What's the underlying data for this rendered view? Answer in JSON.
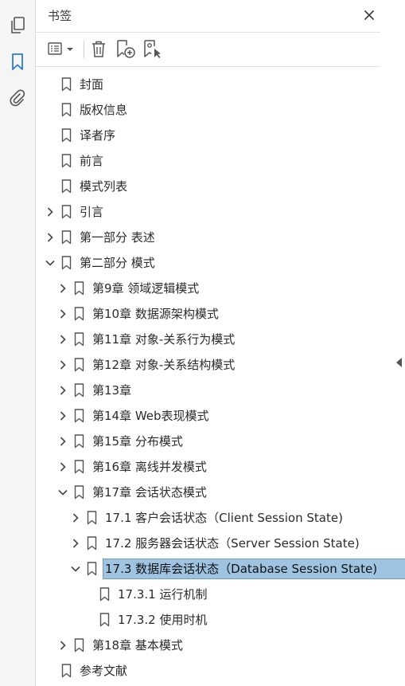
{
  "panel": {
    "title": "书签"
  },
  "colors": {
    "accent": "#2d7ad6",
    "selection": "#9fc4e2",
    "icon": "#555555"
  },
  "rail": {
    "icons": [
      "pages-icon",
      "bookmark-icon",
      "attachment-icon"
    ]
  },
  "toolbar": {
    "icons": [
      "options-menu-icon",
      "delete-bookmark-icon",
      "new-bookmark-icon",
      "find-bookmark-icon"
    ]
  },
  "bookmarks": [
    {
      "label": "封面",
      "level": 0,
      "expander": "none"
    },
    {
      "label": "版权信息",
      "level": 0,
      "expander": "none"
    },
    {
      "label": "译者序",
      "level": 0,
      "expander": "none"
    },
    {
      "label": "前言",
      "level": 0,
      "expander": "none"
    },
    {
      "label": "模式列表",
      "level": 0,
      "expander": "none"
    },
    {
      "label": "引言",
      "level": 0,
      "expander": "collapsed"
    },
    {
      "label": "第一部分 表述",
      "level": 0,
      "expander": "collapsed"
    },
    {
      "label": "第二部分 模式",
      "level": 0,
      "expander": "expanded"
    },
    {
      "label": "第9章 领域逻辑模式",
      "level": 1,
      "expander": "collapsed"
    },
    {
      "label": "第10章 数据源架构模式",
      "level": 1,
      "expander": "collapsed"
    },
    {
      "label": "第11章 对象-关系行为模式",
      "level": 1,
      "expander": "collapsed"
    },
    {
      "label": "第12章 对象-关系结构模式",
      "level": 1,
      "expander": "collapsed"
    },
    {
      "label": "第13章",
      "level": 1,
      "expander": "collapsed"
    },
    {
      "label": "第14章 Web表现模式",
      "level": 1,
      "expander": "collapsed"
    },
    {
      "label": "第15章 分布模式",
      "level": 1,
      "expander": "collapsed"
    },
    {
      "label": "第16章 离线并发模式",
      "level": 1,
      "expander": "collapsed"
    },
    {
      "label": "第17章 会话状态模式",
      "level": 1,
      "expander": "expanded"
    },
    {
      "label": "17.1 客户会话状态（Client Session State)",
      "level": 2,
      "expander": "collapsed"
    },
    {
      "label": "17.2 服务器会话状态（Server Session State)",
      "level": 2,
      "expander": "collapsed"
    },
    {
      "label": "17.3 数据库会话状态（Database Session State)",
      "level": 2,
      "expander": "expanded",
      "selected": true
    },
    {
      "label": "17.3.1 运行机制",
      "level": 3,
      "expander": "none"
    },
    {
      "label": "17.3.2 使用时机",
      "level": 3,
      "expander": "none"
    },
    {
      "label": "第18章 基本模式",
      "level": 1,
      "expander": "collapsed"
    },
    {
      "label": "参考文献",
      "level": 0,
      "expander": "none"
    }
  ]
}
